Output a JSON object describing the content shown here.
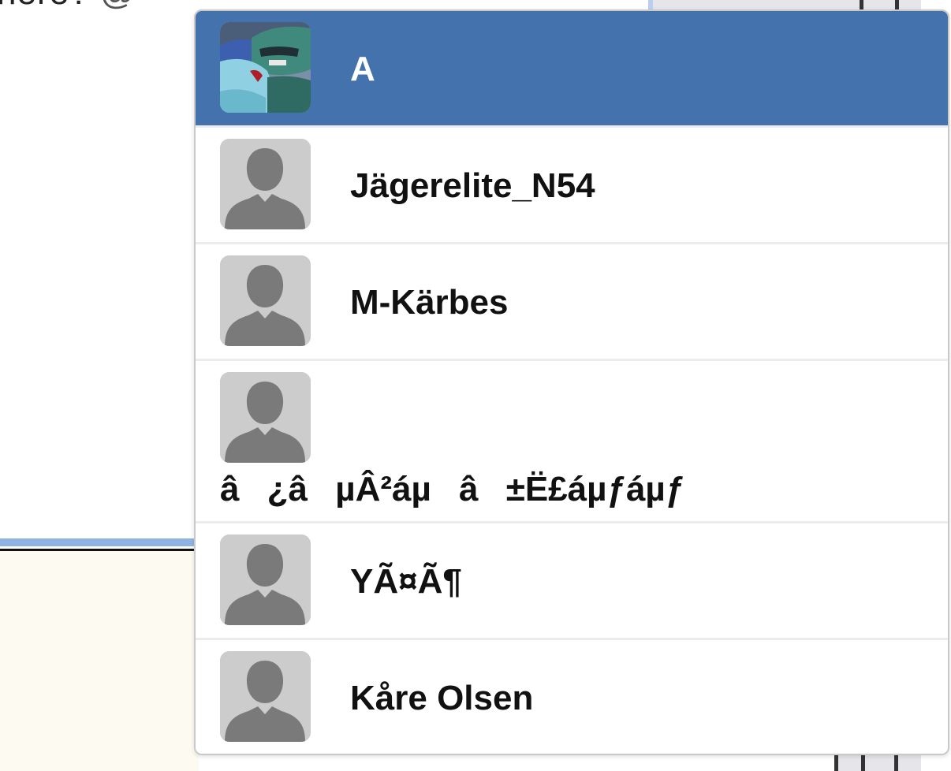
{
  "background": {
    "text_fragment": "here?",
    "at_symbol": "@"
  },
  "mention_dropdown": {
    "accent_color": "#4372ad",
    "selected_index": 0,
    "items": [
      {
        "username": "A",
        "avatar": "car-photo-avatar"
      },
      {
        "username": "Jägerelite_N54",
        "avatar": "default-user-icon"
      },
      {
        "username": "M-Kärbes",
        "avatar": "default-user-icon"
      },
      {
        "username": "â¿âµÂ²áµâ±Ë£áµƒáµƒ",
        "avatar": "default-user-icon"
      },
      {
        "username": "YÃ¤Ã¶",
        "avatar": "default-user-icon"
      },
      {
        "username": "Kåre Olsen",
        "avatar": "default-user-icon"
      }
    ]
  }
}
